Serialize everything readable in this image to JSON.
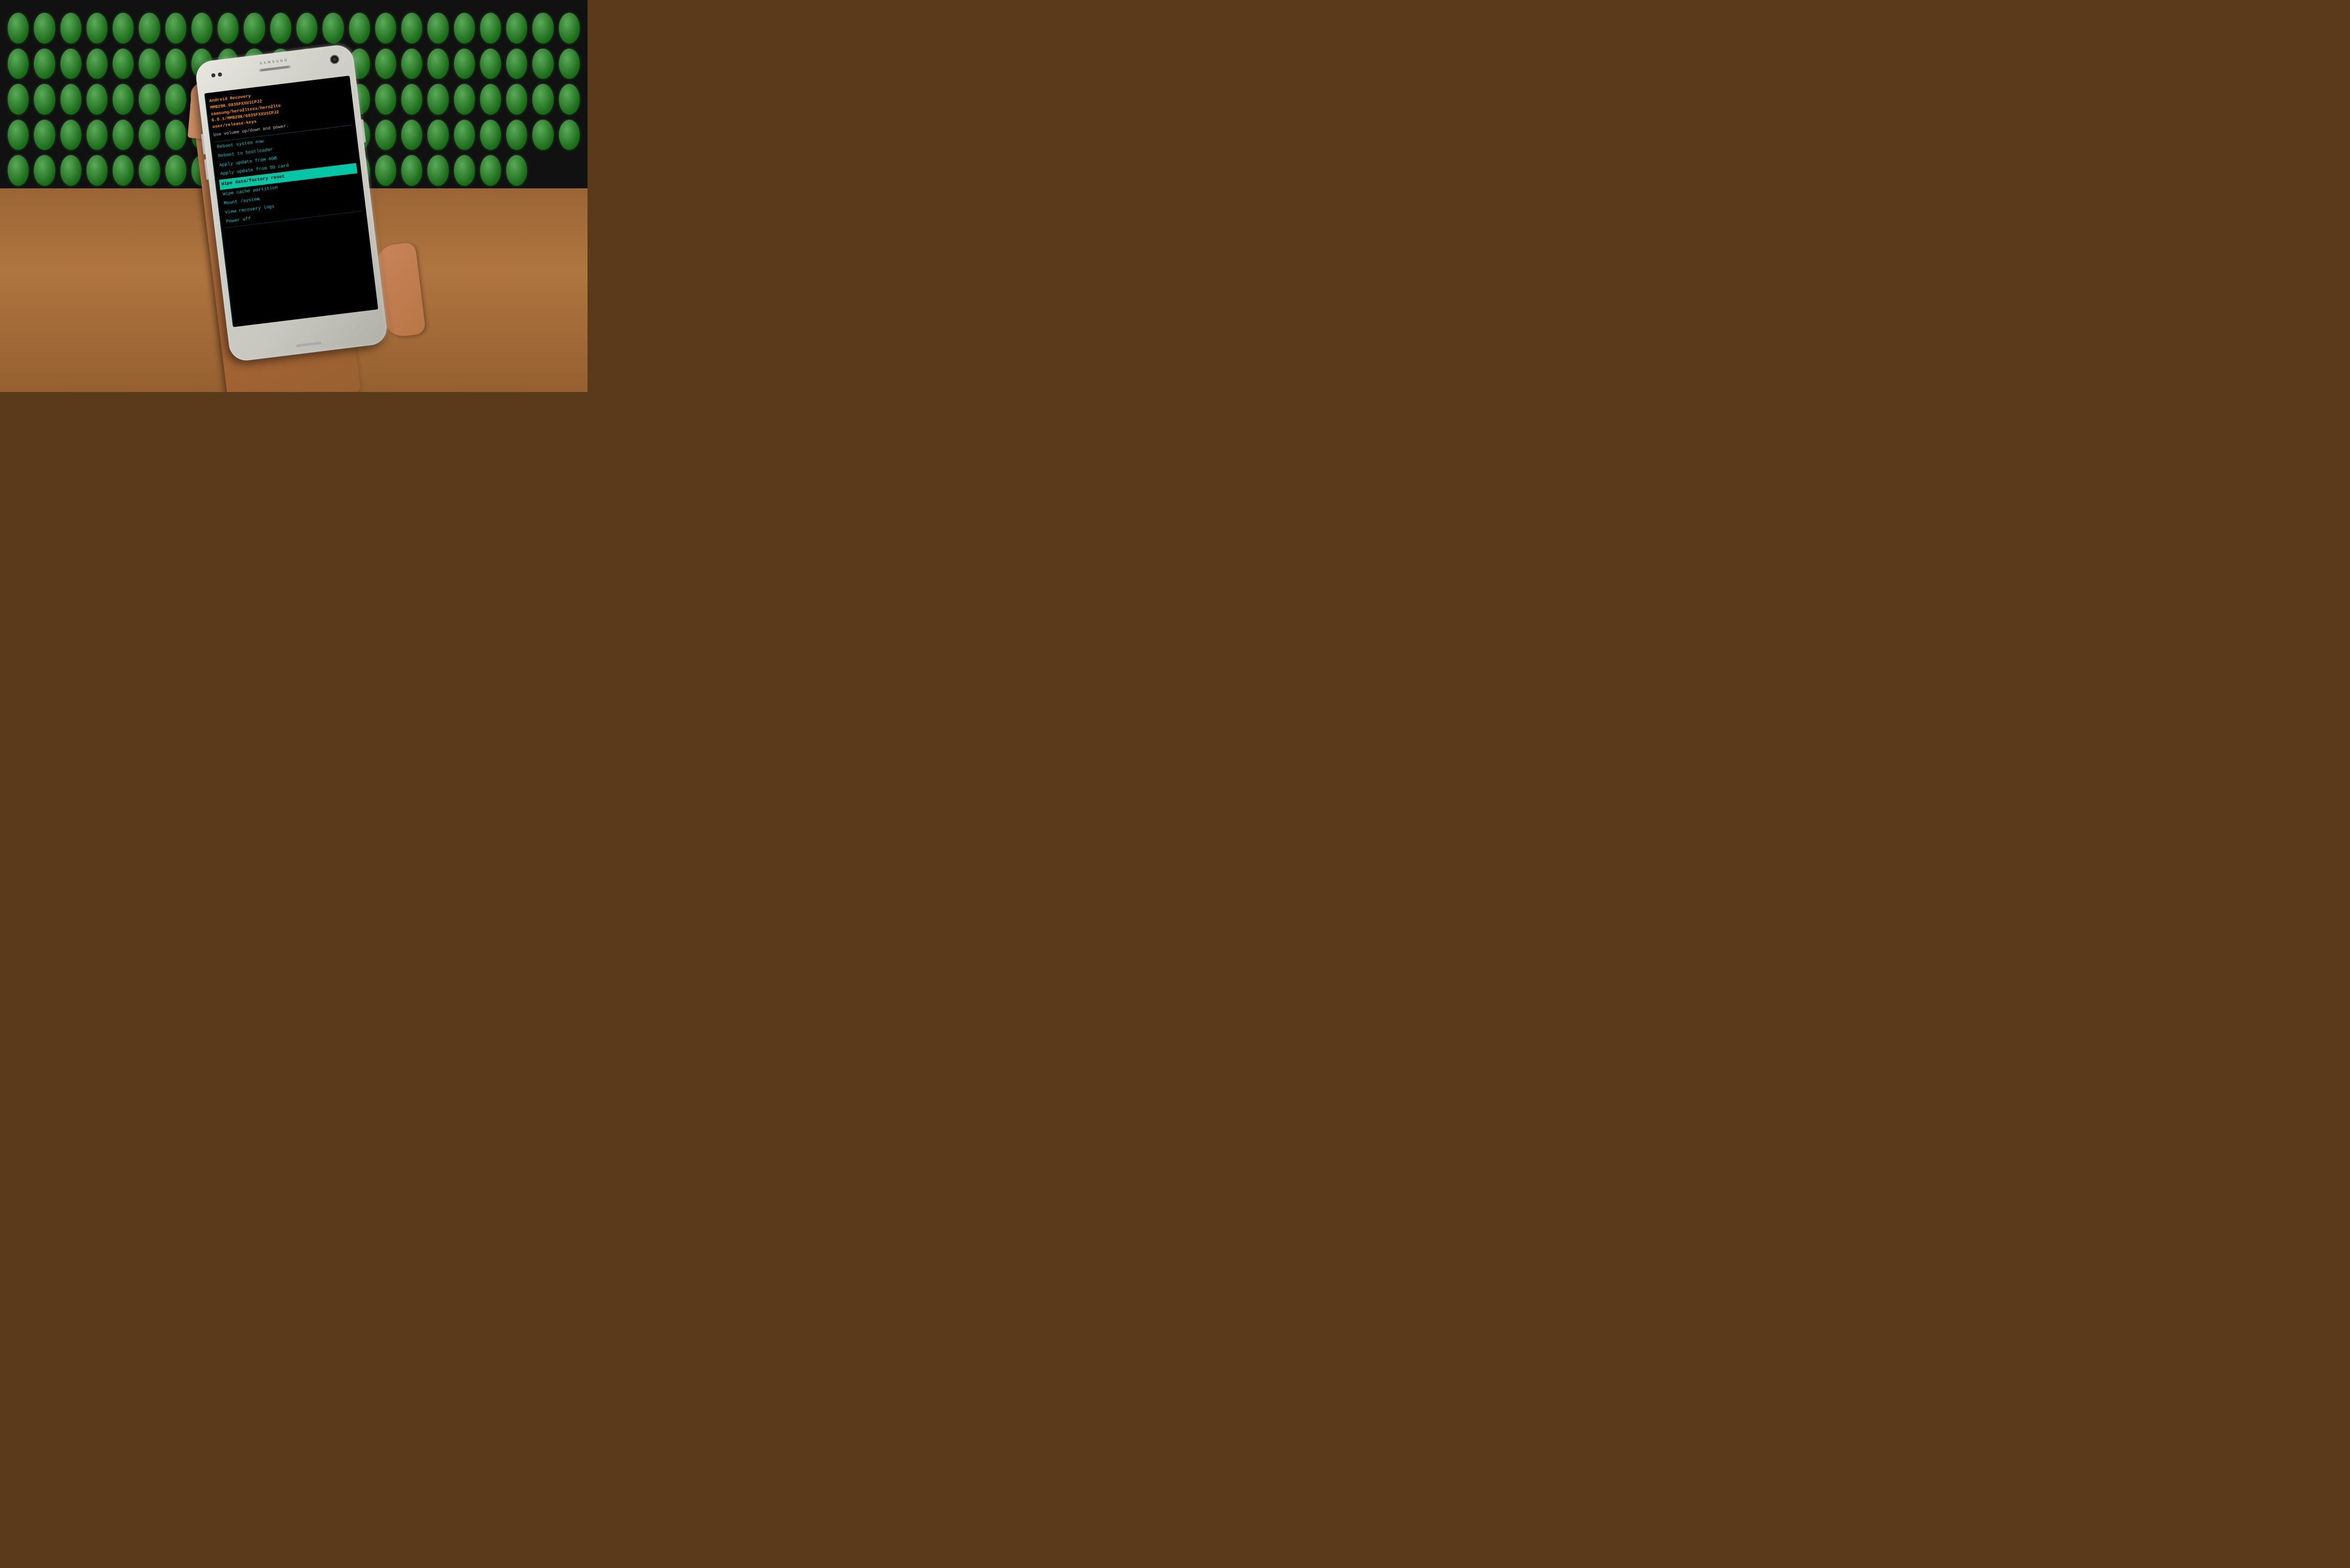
{
  "scene": {
    "phone": {
      "brand": "SAMSUNG",
      "screen": {
        "header": {
          "line1": "Android Recovery",
          "line2": "MMB29K.G935FXXU1CPJ2",
          "line3": "samsung/hero2ltexx/hero2lte",
          "line4": "6.0.1/MMB29K/G935FXXU1CPJ2",
          "line5": "user/release-keys"
        },
        "instruction": "Use volume up/down and power.",
        "menu_items": [
          {
            "label": "Reboot system now",
            "selected": false
          },
          {
            "label": "Reboot to bootloader",
            "selected": false
          },
          {
            "label": "Apply update from ADB",
            "selected": false
          },
          {
            "label": "Apply update from SD card",
            "selected": false
          },
          {
            "label": "Wipe data/factory reset",
            "selected": true
          },
          {
            "label": "Wipe cache partition",
            "selected": false
          },
          {
            "label": "Mount /system",
            "selected": false
          },
          {
            "label": "View recovery logs",
            "selected": false
          },
          {
            "label": "Power off",
            "selected": false
          }
        ]
      }
    }
  },
  "colors": {
    "screen_bg": "#000000",
    "header_text": "#ff9900",
    "menu_text": "#00cccc",
    "selected_bg": "#00ccaa",
    "selected_text": "#000000",
    "instruction_text": "#cccccc",
    "phone_body": "#d8d8d0",
    "keyboard_key": "#2a7a2a",
    "desk": "#9a6535"
  }
}
